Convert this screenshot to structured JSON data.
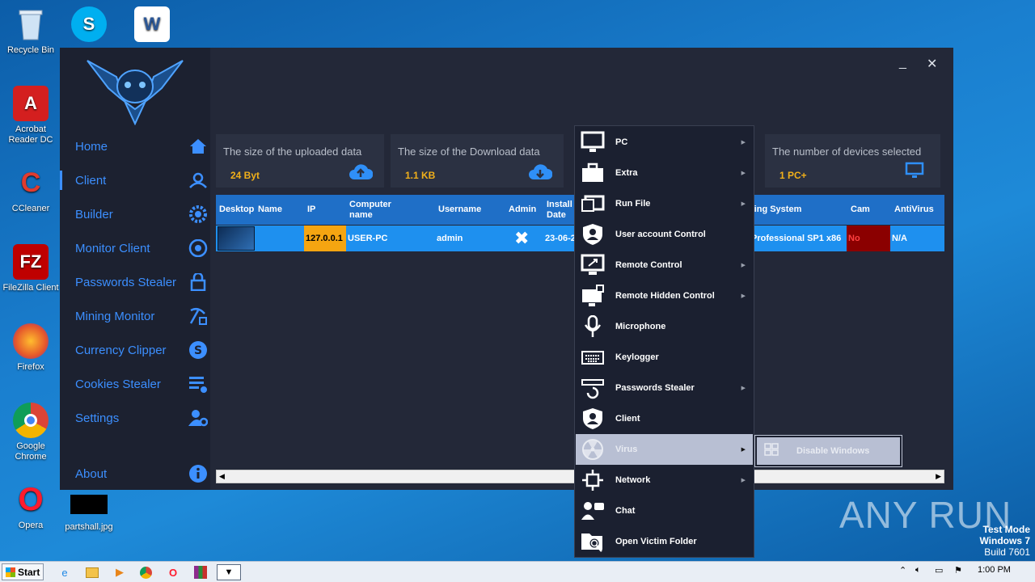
{
  "desktop": {
    "icons": [
      {
        "label": "Recycle Bin",
        "icon": "recycle-bin-icon"
      },
      {
        "label": "",
        "icon": "skype-icon"
      },
      {
        "label": "",
        "icon": "word-document-icon"
      },
      {
        "label": "Acrobat Reader DC",
        "icon": "acrobat-icon"
      },
      {
        "label": "CCleaner",
        "icon": "ccleaner-icon"
      },
      {
        "label": "FileZilla Client",
        "icon": "filezilla-icon"
      },
      {
        "label": "Firefox",
        "icon": "firefox-icon"
      },
      {
        "label": "Google Chrome",
        "icon": "chrome-icon"
      },
      {
        "label": "Opera",
        "icon": "opera-icon"
      },
      {
        "label": "partshall.jpg",
        "icon": "image-file-icon"
      }
    ]
  },
  "window": {
    "minimize": "_",
    "close": "✕"
  },
  "sidebar": {
    "items": [
      {
        "label": "Home",
        "icon": "home-icon"
      },
      {
        "label": "Client",
        "icon": "user-icon"
      },
      {
        "label": "Builder",
        "icon": "gear-icon"
      },
      {
        "label": "Monitor Client",
        "icon": "eye-icon"
      },
      {
        "label": "Passwords Stealer",
        "icon": "lock-icon"
      },
      {
        "label": "Mining Monitor",
        "icon": "pickaxe-icon"
      },
      {
        "label": "Currency Clipper",
        "icon": "currency-icon"
      },
      {
        "label": "Cookies Stealer",
        "icon": "list-icon"
      },
      {
        "label": "Settings",
        "icon": "user-settings-icon"
      },
      {
        "label": "About",
        "icon": "info-icon"
      }
    ]
  },
  "cards": [
    {
      "title": "The size of the uploaded data",
      "value": "24 Byt",
      "icon": "cloud-upload-icon"
    },
    {
      "title": "The size of the Download data",
      "value": "1.1 KB",
      "icon": "cloud-download-icon"
    },
    {
      "title": "The number of devices selected",
      "value": "1 PC+",
      "icon": "monitor-icon"
    }
  ],
  "table": {
    "headers": [
      "Desktop",
      "Name",
      "IP",
      "Computer name",
      "Username",
      "Admin",
      "Install Date",
      "ting System",
      "Cam",
      "AntiVirus"
    ],
    "row": {
      "desktop": "",
      "name": "",
      "ip": "127.0.0.1",
      "computer": "USER-PC",
      "username": "admin",
      "admin": "✖",
      "install": "23-06-2",
      "os": "Professional SP1 x86",
      "cam": "No",
      "antivirus": "N/A"
    }
  },
  "context_menu": {
    "items": [
      {
        "label": "PC",
        "icon": "monitor-icon",
        "submenu": true
      },
      {
        "label": "Extra",
        "icon": "briefcase-icon",
        "submenu": true
      },
      {
        "label": "Run File",
        "icon": "run-file-icon",
        "submenu": true
      },
      {
        "label": "User account Control",
        "icon": "shield-user-icon",
        "submenu": false
      },
      {
        "label": "Remote Control",
        "icon": "remote-desktop-icon",
        "submenu": true
      },
      {
        "label": "Remote Hidden Control",
        "icon": "hidden-remote-icon",
        "submenu": true
      },
      {
        "label": "Microphone",
        "icon": "microphone-icon",
        "submenu": false
      },
      {
        "label": "Keylogger",
        "icon": "keyboard-icon",
        "submenu": false
      },
      {
        "label": "Passwords Stealer",
        "icon": "password-icon",
        "submenu": true
      },
      {
        "label": "Client",
        "icon": "shield-user-icon",
        "submenu": false
      },
      {
        "label": "Virus",
        "icon": "radiation-icon",
        "submenu": true
      },
      {
        "label": "Network",
        "icon": "network-icon",
        "submenu": true
      },
      {
        "label": "Chat",
        "icon": "chat-icon",
        "submenu": false
      },
      {
        "label": "Open Victim Folder",
        "icon": "folder-search-icon",
        "submenu": false
      }
    ],
    "submenu_item": "Disable Windows"
  },
  "taskbar": {
    "start": "Start",
    "time": "1:00 PM"
  },
  "os_watermark": {
    "line1": "Test Mode",
    "line2": "Windows 7",
    "line3": "Build 7601"
  },
  "anyrun": "ANY RUN",
  "colors": {
    "accent": "#3c8fff",
    "ip_highlight": "#f5a511",
    "cam_red": "#8b0000",
    "row_blue": "#1e90ef"
  }
}
